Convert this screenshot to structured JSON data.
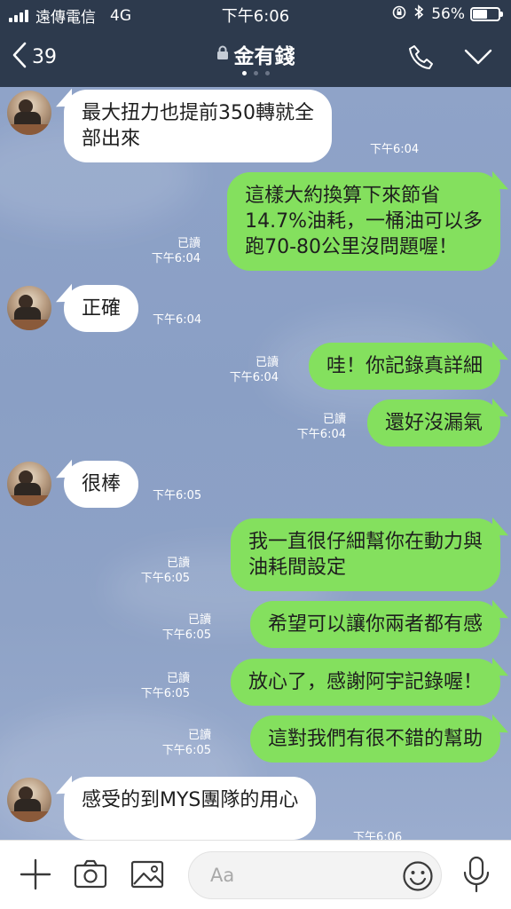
{
  "status_bar": {
    "carrier": "遠傳電信",
    "network": "4G",
    "time": "下午6:06",
    "battery": "56%",
    "battery_level": 0.56
  },
  "header": {
    "back_count": "39",
    "title": "金有錢"
  },
  "messages": [
    {
      "side": "in",
      "text": "最大扭力也提前350轉就全\n部出來",
      "time": "下午6:04"
    },
    {
      "side": "out",
      "text": "這樣大約換算下來節省\n14.7%油耗，一桶油可以多\n跑70-80公里沒問題喔！",
      "read": "已讀",
      "time": "下午6:04"
    },
    {
      "side": "in",
      "text": "正確",
      "time": "下午6:04"
    },
    {
      "side": "out",
      "text": "哇！你記錄真詳細",
      "read": "已讀",
      "time": "下午6:04"
    },
    {
      "side": "out",
      "text": "還好沒漏氣",
      "read": "已讀",
      "time": "下午6:04"
    },
    {
      "side": "in",
      "text": "很棒",
      "time": "下午6:05"
    },
    {
      "side": "out",
      "text": "我一直很仔細幫你在動力與\n油耗間設定",
      "read": "已讀",
      "time": "下午6:05"
    },
    {
      "side": "out",
      "text": "希望可以讓你兩者都有感",
      "read": "已讀",
      "time": "下午6:05"
    },
    {
      "side": "out",
      "text": "放心了，感謝阿宇記錄喔！",
      "read": "已讀",
      "time": "下午6:05"
    },
    {
      "side": "out",
      "text": "這對我們有很不錯的幫助",
      "read": "已讀",
      "time": "下午6:05"
    },
    {
      "side": "in",
      "text": "感受的到MYS團隊的用心",
      "time": "下午6:06"
    }
  ],
  "input": {
    "placeholder": "Aa"
  },
  "icons": {
    "back": "chevron-left-icon",
    "lock": "lock-icon",
    "call": "phone-icon",
    "menu": "chevron-down-icon",
    "add": "plus-icon",
    "camera": "camera-icon",
    "image": "image-icon",
    "emoji": "emoji-icon",
    "mic": "microphone-icon"
  },
  "colors": {
    "header_bg": "#2d3a4d",
    "outgoing_bubble": "#84e05e",
    "incoming_bubble": "#ffffff",
    "chat_bg": "#8fa3c8"
  }
}
